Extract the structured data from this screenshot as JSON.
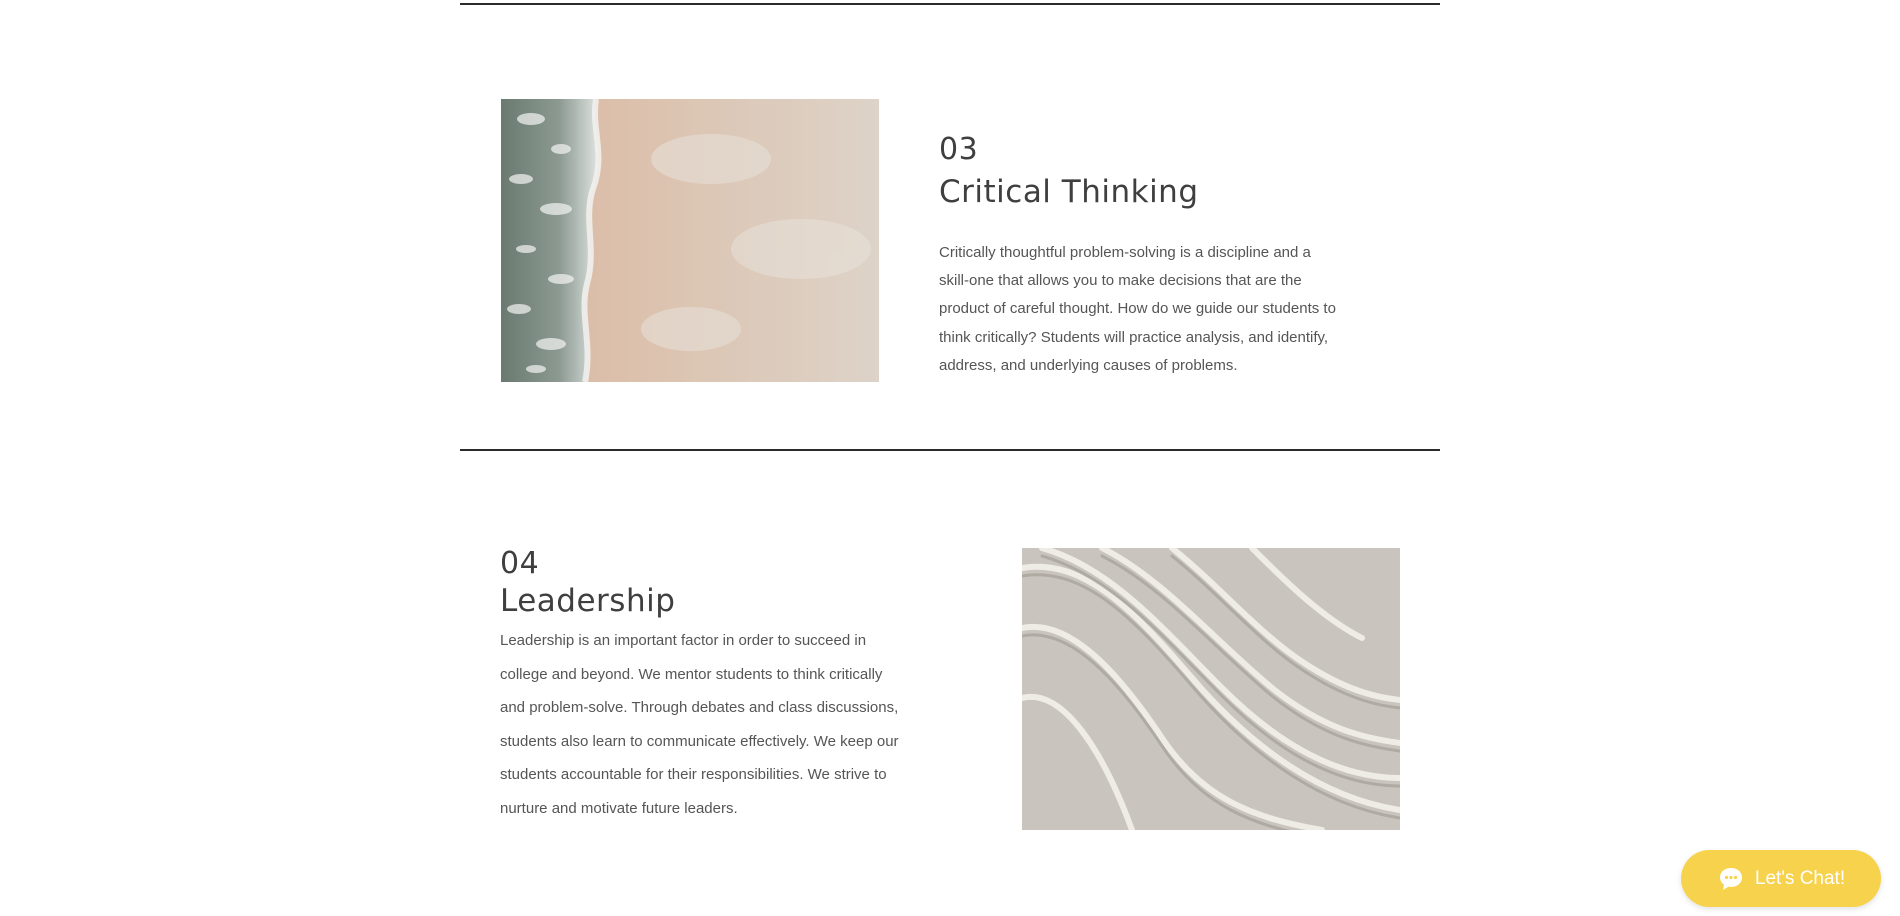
{
  "sections": [
    {
      "number": "03",
      "title": "Critical Thinking",
      "body": "Critically thoughtful problem-solving is a discipline and a skill-one that allows you to make decisions that are the product of careful thought. How do we guide our students to think critically? Students will practice analysis, and identify, address, and underlying causes of problems."
    },
    {
      "number": "04",
      "title": "Leadership",
      "body": "Leadership is an important factor in order to succeed in college and beyond. We mentor students to think critically and problem-solve. Through debates and class discussions, students also learn to communicate effectively. We keep our students accountable for their responsibilities. We strive to nurture and motivate future leaders."
    }
  ],
  "chat": {
    "label": "Let's Chat!",
    "icon": "chat-bubble-icon"
  },
  "colors": {
    "accent": "#f7d24c",
    "divider": "#2b2b2b",
    "heading": "#3f3f3f",
    "text": "#555555"
  }
}
